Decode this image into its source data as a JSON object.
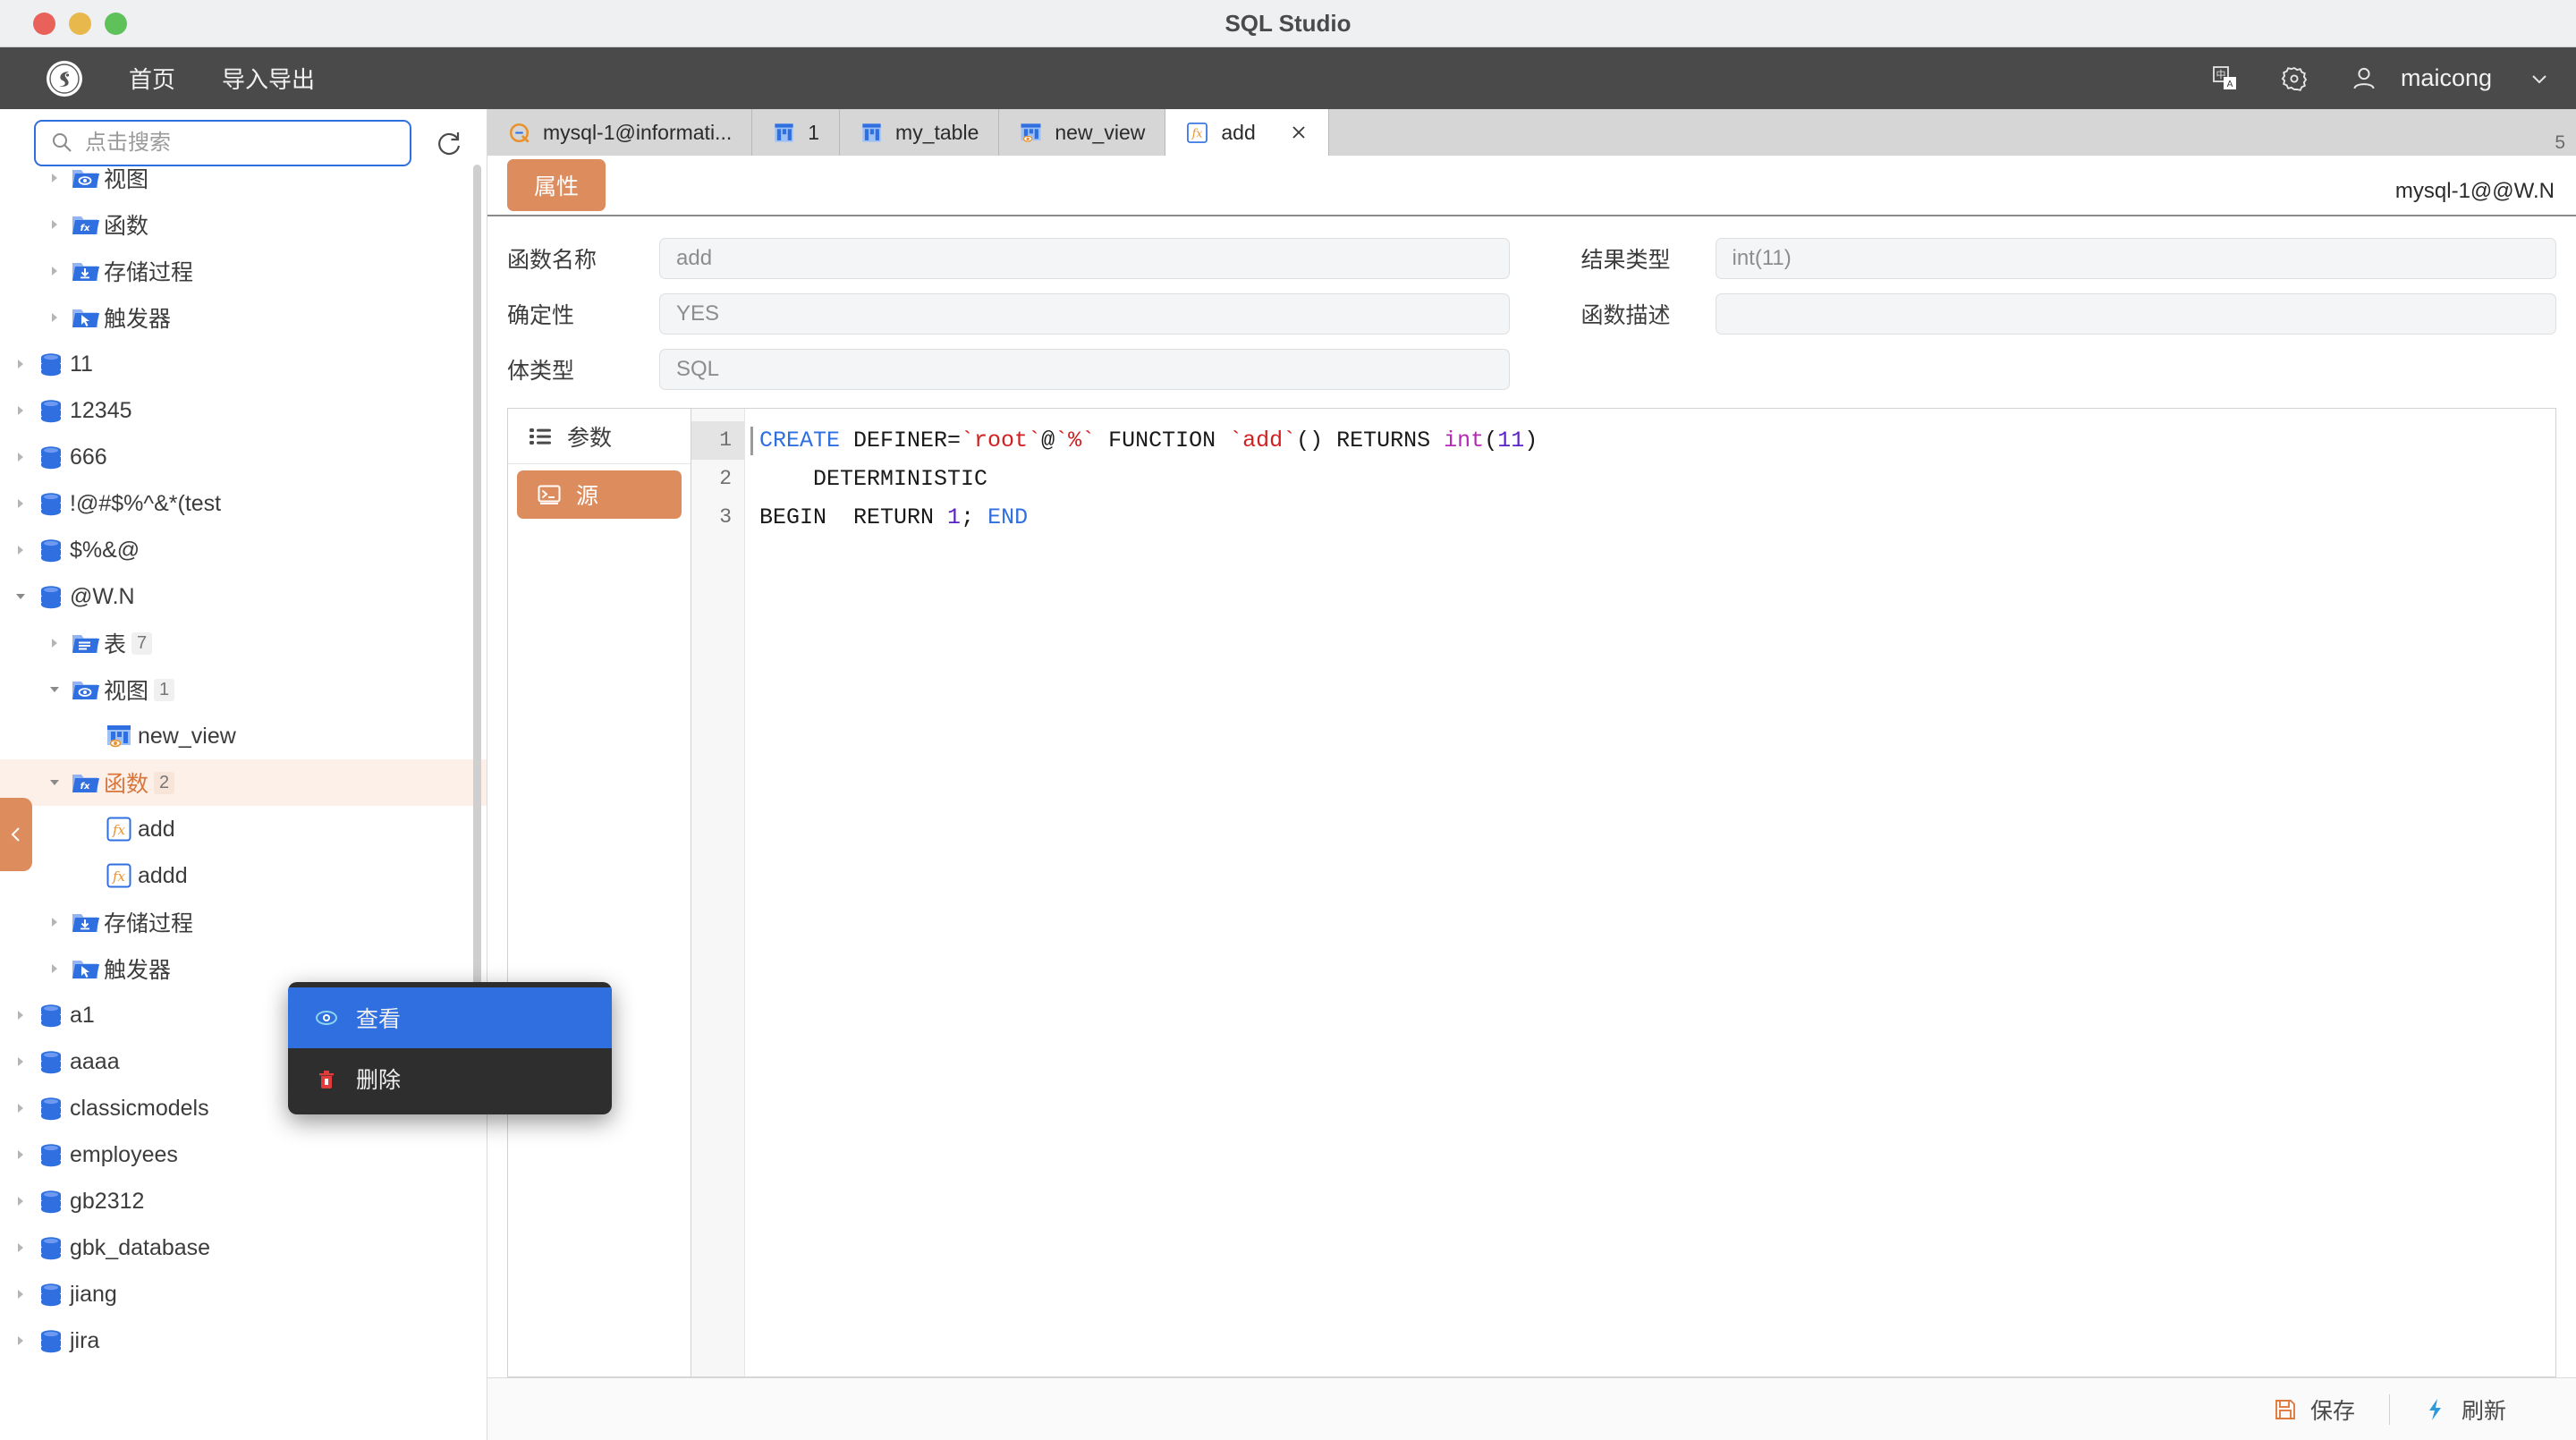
{
  "window": {
    "title": "SQL Studio"
  },
  "appbar": {
    "logo_icon": "s-logo-icon",
    "nav": [
      {
        "label": "首页",
        "name": "nav-home"
      },
      {
        "label": "导入导出",
        "name": "nav-import-export"
      }
    ],
    "language_icon": "language-toggle-icon",
    "settings_icon": "gear-icon",
    "user_icon": "user-icon",
    "username": "maicong",
    "caret_icon": "chevron-down-icon"
  },
  "sidebar": {
    "search": {
      "placeholder": "点击搜索",
      "value": "",
      "icon": "search-icon"
    },
    "refresh_icon": "refresh-icon",
    "collapse_icon": "chevron-left-icon",
    "tree": [
      {
        "label": "视图",
        "icon": "folder-view-icon",
        "indent": 2,
        "expand": "collapsed",
        "count": ""
      },
      {
        "label": "函数",
        "icon": "folder-function-icon",
        "indent": 2,
        "expand": "collapsed",
        "count": ""
      },
      {
        "label": "存储过程",
        "icon": "folder-procedure-icon",
        "indent": 2,
        "expand": "collapsed",
        "count": ""
      },
      {
        "label": "触发器",
        "icon": "folder-trigger-icon",
        "indent": 2,
        "expand": "collapsed",
        "count": ""
      },
      {
        "label": "11",
        "icon": "database-icon",
        "indent": 1,
        "expand": "collapsed",
        "count": ""
      },
      {
        "label": "12345",
        "icon": "database-icon",
        "indent": 1,
        "expand": "collapsed",
        "count": ""
      },
      {
        "label": "666",
        "icon": "database-icon",
        "indent": 1,
        "expand": "collapsed",
        "count": ""
      },
      {
        "label": "!@#$%^&*(test",
        "icon": "database-icon",
        "indent": 1,
        "expand": "collapsed",
        "count": ""
      },
      {
        "label": "$%&@",
        "icon": "database-icon",
        "indent": 1,
        "expand": "collapsed",
        "count": ""
      },
      {
        "label": "@W.N",
        "icon": "database-icon",
        "indent": 1,
        "expand": "expanded",
        "count": ""
      },
      {
        "label": "表",
        "icon": "folder-table-icon",
        "indent": 2,
        "expand": "collapsed",
        "count": "7"
      },
      {
        "label": "视图",
        "icon": "folder-view-icon",
        "indent": 2,
        "expand": "expanded",
        "count": "1"
      },
      {
        "label": "new_view",
        "icon": "view-icon",
        "indent": 3,
        "expand": "none",
        "count": ""
      },
      {
        "label": "函数",
        "icon": "folder-function-icon",
        "indent": 2,
        "expand": "expanded",
        "count": "2",
        "highlight": true
      },
      {
        "label": "add",
        "icon": "function-icon",
        "indent": 3,
        "expand": "none",
        "count": ""
      },
      {
        "label": "addd",
        "icon": "function-icon",
        "indent": 3,
        "expand": "none",
        "count": ""
      },
      {
        "label": "存储过程",
        "icon": "folder-procedure-icon",
        "indent": 2,
        "expand": "collapsed",
        "count": ""
      },
      {
        "label": "触发器",
        "icon": "folder-trigger-icon",
        "indent": 2,
        "expand": "collapsed",
        "count": ""
      },
      {
        "label": "a1",
        "icon": "database-icon",
        "indent": 1,
        "expand": "collapsed",
        "count": ""
      },
      {
        "label": "aaaa",
        "icon": "database-icon",
        "indent": 1,
        "expand": "collapsed",
        "count": ""
      },
      {
        "label": "classicmodels",
        "icon": "database-icon",
        "indent": 1,
        "expand": "collapsed",
        "count": ""
      },
      {
        "label": "employees",
        "icon": "database-icon",
        "indent": 1,
        "expand": "collapsed",
        "count": ""
      },
      {
        "label": "gb2312",
        "icon": "database-icon",
        "indent": 1,
        "expand": "collapsed",
        "count": ""
      },
      {
        "label": "gbk_database",
        "icon": "database-icon",
        "indent": 1,
        "expand": "collapsed",
        "count": ""
      },
      {
        "label": "jiang",
        "icon": "database-icon",
        "indent": 1,
        "expand": "collapsed",
        "count": ""
      },
      {
        "label": "jira",
        "icon": "database-icon",
        "indent": 1,
        "expand": "collapsed",
        "count": ""
      }
    ]
  },
  "context_menu": {
    "items": [
      {
        "label": "查看",
        "icon": "eye-icon",
        "active": true
      },
      {
        "label": "删除",
        "icon": "trash-icon",
        "active": false
      }
    ]
  },
  "tabs": {
    "items": [
      {
        "label": "mysql-1@informati...",
        "icon": "connection-icon",
        "active": false,
        "closable": false
      },
      {
        "label": "1",
        "icon": "table-icon",
        "active": false,
        "closable": false
      },
      {
        "label": "my_table",
        "icon": "table-icon",
        "active": false,
        "closable": false
      },
      {
        "label": "new_view",
        "icon": "view-icon",
        "active": false,
        "closable": false
      },
      {
        "label": "add",
        "icon": "function-icon",
        "active": true,
        "closable": true
      }
    ],
    "overflow_count": "5",
    "close_icon": "close-icon"
  },
  "properties": {
    "tab_label": "属性",
    "breadcrumb": "mysql-1@@W.N",
    "fields_left": [
      {
        "label": "函数名称",
        "value": "add",
        "name": "function-name-field"
      },
      {
        "label": "确定性",
        "value": "YES",
        "name": "deterministic-field"
      },
      {
        "label": "体类型",
        "value": "SQL",
        "name": "body-type-field"
      }
    ],
    "fields_right": [
      {
        "label": "结果类型",
        "value": "int(11)",
        "name": "result-type-field"
      },
      {
        "label": "函数描述",
        "value": "",
        "name": "function-comment-field"
      }
    ]
  },
  "editor": {
    "side_tabs": [
      {
        "label": "参数",
        "icon": "list-icon",
        "active": false
      },
      {
        "label": "源",
        "icon": "terminal-icon",
        "active": true
      }
    ],
    "line_numbers": [
      "1",
      "2",
      "3"
    ],
    "current_line": 1,
    "code_lines": [
      [
        {
          "t": "CREATE",
          "c": "kw"
        },
        {
          "t": " DEFINER=",
          "c": ""
        },
        {
          "t": "`root`",
          "c": "str"
        },
        {
          "t": "@",
          "c": ""
        },
        {
          "t": "`%`",
          "c": "str"
        },
        {
          "t": " FUNCTION ",
          "c": ""
        },
        {
          "t": "`add`",
          "c": "str"
        },
        {
          "t": "() RETURNS ",
          "c": ""
        },
        {
          "t": "int",
          "c": "typ"
        },
        {
          "t": "(",
          "c": ""
        },
        {
          "t": "11",
          "c": "num"
        },
        {
          "t": ")",
          "c": ""
        }
      ],
      [
        {
          "t": "    DETERMINISTIC",
          "c": ""
        }
      ],
      [
        {
          "t": "BEGIN  RETURN ",
          "c": ""
        },
        {
          "t": "1",
          "c": "num"
        },
        {
          "t": "; ",
          "c": ""
        },
        {
          "t": "END",
          "c": "kw"
        }
      ]
    ]
  },
  "bottom_bar": {
    "save": {
      "label": "保存",
      "icon": "save-icon"
    },
    "refresh": {
      "label": "刷新",
      "icon": "lightning-refresh-icon"
    }
  },
  "colors": {
    "accent_orange": "#dd8c5d",
    "menu_blue": "#2f6fe0",
    "db_blue": "#2f6fe0",
    "danger_red": "#e23b3b",
    "header_dark": "#4a4a4a"
  }
}
